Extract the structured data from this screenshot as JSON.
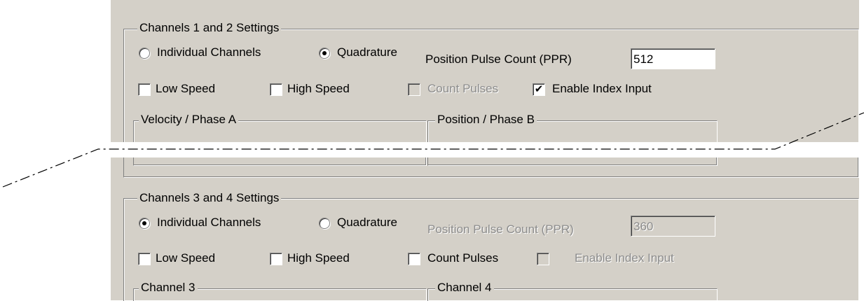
{
  "group1": {
    "title": "Channels 1 and 2 Settings",
    "mode_individual_label": "Individual Channels",
    "mode_quadrature_label": "Quadrature",
    "ppr_label": "Position Pulse Count (PPR)",
    "ppr_value": "512",
    "low_speed_label": "Low Speed",
    "high_speed_label": "High Speed",
    "count_pulses_label": "Count Pulses",
    "enable_index_label": "Enable Index Input",
    "subgroup_left_title": "Velocity / Phase A",
    "subgroup_right_title": "Position / Phase B",
    "selected_mode": "Quadrature",
    "enable_index_checked": true
  },
  "group2": {
    "title": "Channels 3 and 4 Settings",
    "mode_individual_label": "Individual Channels",
    "mode_quadrature_label": "Quadrature",
    "ppr_label": "Position Pulse Count (PPR)",
    "ppr_value": "360",
    "low_speed_label": "Low Speed",
    "high_speed_label": "High Speed",
    "count_pulses_label": "Count Pulses",
    "enable_index_label": "Enable Index Input",
    "subgroup_left_title": "Channel 3",
    "subgroup_right_title": "Channel 4",
    "selected_mode": "Individual Channels"
  },
  "colors": {
    "dialog_background": "#d4d0c8",
    "disabled_text": "#8c8c8c",
    "cut_line": "#000000"
  }
}
